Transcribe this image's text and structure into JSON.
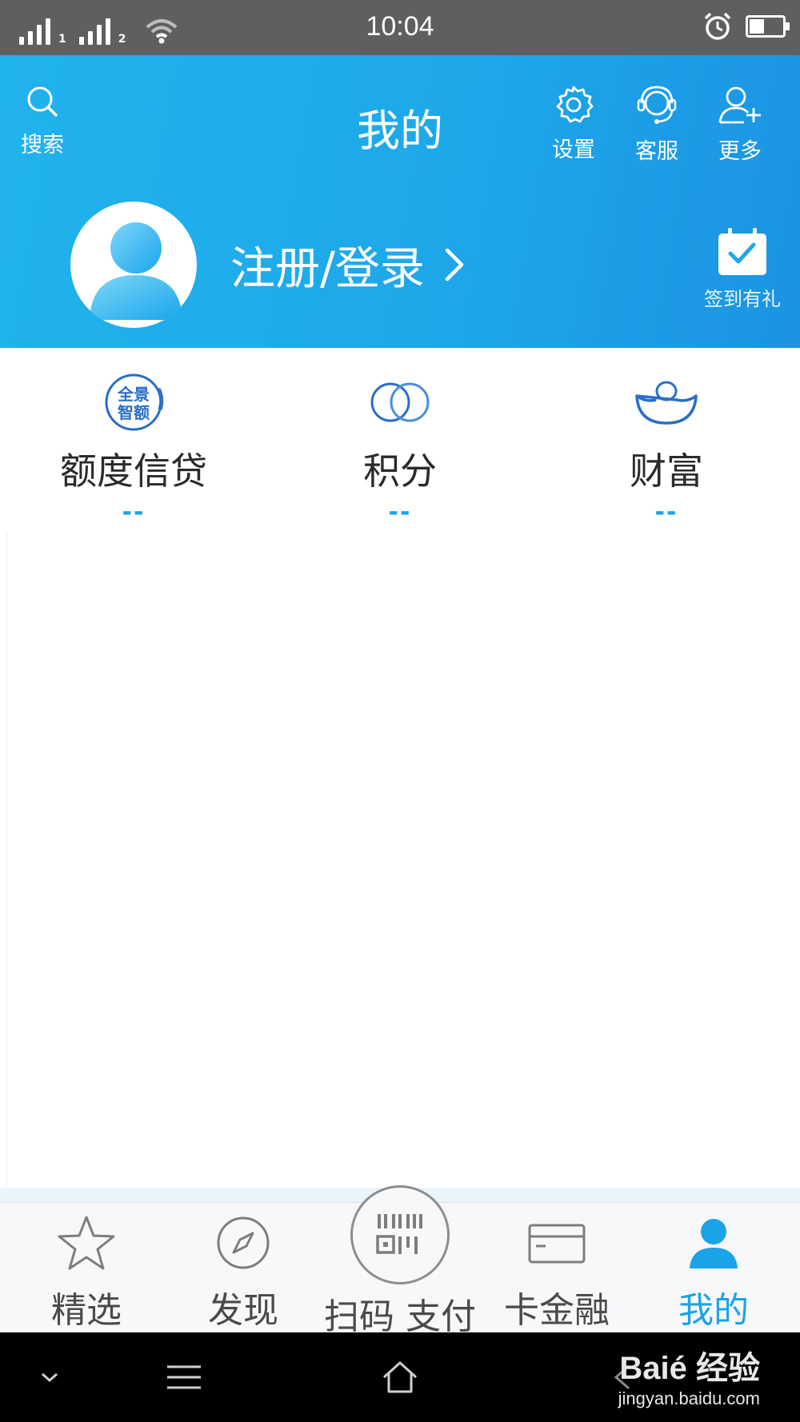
{
  "status_bar": {
    "time": "10:04",
    "sim1": "1",
    "sim2": "2",
    "battery_level": 0.45
  },
  "header": {
    "title": "我的",
    "search_label": "搜索",
    "settings_label": "设置",
    "service_label": "客服",
    "more_label": "更多"
  },
  "profile": {
    "login_text": "注册/登录",
    "signin_label": "签到有礼"
  },
  "stats": [
    {
      "name": "额度信贷",
      "value": "--",
      "badge_line1": "全景",
      "badge_line2": "智额"
    },
    {
      "name": "积分",
      "value": "--"
    },
    {
      "name": "财富",
      "value": "--"
    }
  ],
  "tabbar": {
    "items": [
      {
        "label": "精选"
      },
      {
        "label": "发现"
      },
      {
        "label": "扫码 支付"
      },
      {
        "label": "卡金融"
      },
      {
        "label": "我的"
      }
    ],
    "active_index": 4
  },
  "watermark": {
    "logo": "Baié 经验",
    "url": "jingyan.baidu.com"
  },
  "colors": {
    "header_blue": "#1da8ea",
    "accent": "#1aa3e8",
    "status_bar": "#5f5f5f"
  }
}
